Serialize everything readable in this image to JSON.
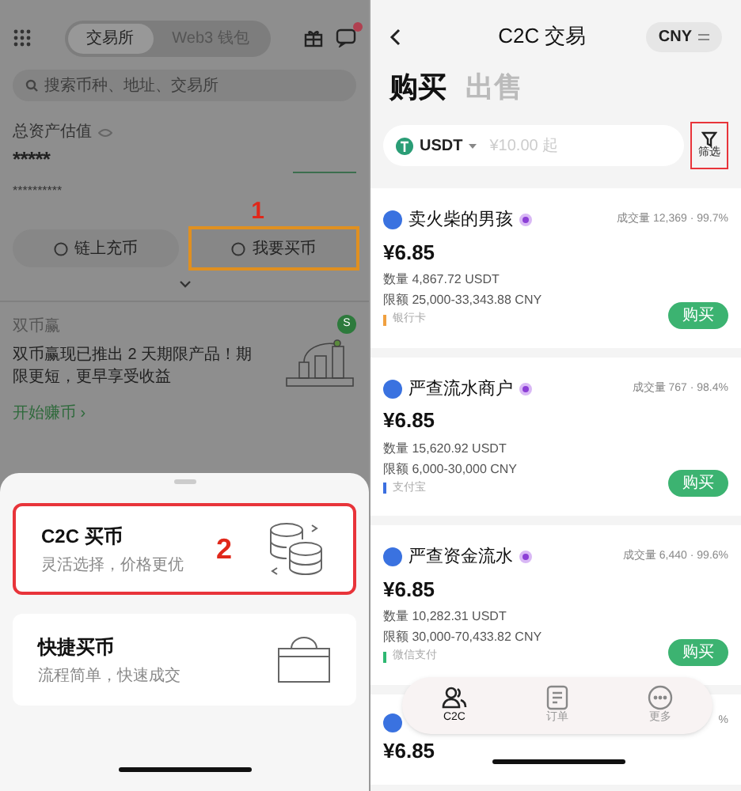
{
  "left": {
    "tabs": [
      {
        "label": "交易所",
        "selected": true
      },
      {
        "label": "Web3 钱包",
        "selected": false
      }
    ],
    "notification_dot": true,
    "search": {
      "placeholder": "搜索币种、地址、交易所"
    },
    "assets": {
      "label": "总资产估值",
      "value": "*****",
      "sub_value": "**********"
    },
    "step_1": "1",
    "actions": [
      {
        "label": "链上充币",
        "highlighted": false
      },
      {
        "label": "我要买币",
        "highlighted": true
      }
    ],
    "promo": {
      "tag": "双币赢",
      "text": "双币赢现已推出 2 天期限产品！期限更短，更早享受收益",
      "link": "开始赚币",
      "link_arrow": "›",
      "badge": "S"
    },
    "sheet": {
      "step_2": "2",
      "options": [
        {
          "kind": "c2c",
          "title": "C2C 买币",
          "subtitle": "灵活选择，价格更优",
          "highlighted": true
        },
        {
          "kind": "quick",
          "title": "快捷买币",
          "subtitle": "流程简单，快速成交",
          "highlighted": false
        }
      ]
    }
  },
  "right": {
    "title": "C2C 交易",
    "currency": "CNY",
    "tabs": [
      {
        "label": "购买",
        "selected": true
      },
      {
        "label": "出售",
        "selected": false
      }
    ],
    "coin": "USDT",
    "amount_placeholder": "¥10.00 起",
    "filter": "筛选",
    "offers": [
      {
        "name": "卖火柴的男孩",
        "stats": "成交量 12,369 · 99.7%",
        "price": "¥6.85",
        "quantity_label": "数量",
        "quantity": "4,867.72 USDT",
        "limit_label": "限额",
        "limit": "25,000-33,343.88 CNY",
        "payment": "银行卡",
        "color": "#f0a040",
        "button": "购买"
      },
      {
        "name": "严查流水商户",
        "stats": "成交量 767 · 98.4%",
        "price": "¥6.85",
        "quantity_label": "数量",
        "quantity": "15,620.92 USDT",
        "limit_label": "限额",
        "limit": "6,000-30,000 CNY",
        "payment": "支付宝",
        "color": "#3b6fe0",
        "button": "购买"
      },
      {
        "name": "严查资金流水",
        "stats": "成交量 6,440 · 99.6%",
        "price": "¥6.85",
        "quantity_label": "数量",
        "quantity": "10,282.31 USDT",
        "limit_label": "限额",
        "limit": "30,000-70,433.82 CNY",
        "payment": "微信支付",
        "color": "#2eb872",
        "button": "购买"
      },
      {
        "stats": "%",
        "price": "¥6.85"
      }
    ],
    "nav": [
      {
        "kind": "people",
        "label": "C2C",
        "selected": true
      },
      {
        "kind": "doc",
        "label": "订单",
        "selected": false
      },
      {
        "kind": "more",
        "label": "更多",
        "selected": false
      }
    ]
  }
}
